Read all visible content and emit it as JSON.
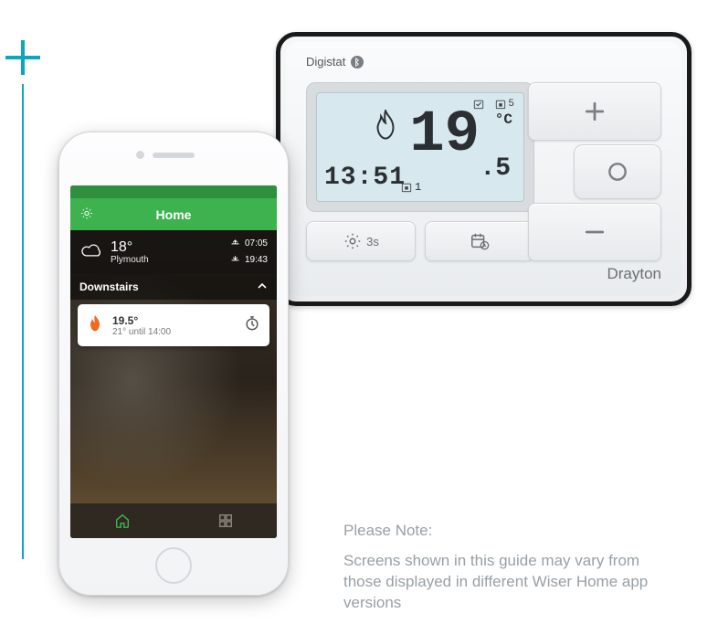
{
  "decor": {
    "accent": "#0aa7bf"
  },
  "thermostat": {
    "model": "Digistat",
    "brand": "Drayton",
    "bluetooth_icon": "bluetooth-icon",
    "lcd": {
      "time": "13:51",
      "flame_icon": "flame-icon",
      "schedule_top_label": "5",
      "temp_int": "19",
      "temp_dec": ".5",
      "temp_unit": "°C",
      "schedule_bottom": "1"
    },
    "buttons": {
      "settings_label": "3s",
      "settings_icon": "gear-icon",
      "schedule_icon": "calendar-clock-icon",
      "plus_icon": "plus-icon",
      "minus_icon": "minus-icon",
      "ok_icon": "circle-icon"
    }
  },
  "phone": {
    "header": {
      "title": "Home",
      "settings_icon": "gear-icon"
    },
    "weather": {
      "icon": "cloud-icon",
      "temp": "18°",
      "location": "Plymouth",
      "sunrise": "07:05",
      "sunset": "19:43"
    },
    "zone": {
      "name": "Downstairs",
      "card": {
        "temp": "19.5°",
        "subtitle": "21° until 14:00",
        "flame_icon": "flame-icon",
        "timer_icon": "stopwatch-icon"
      }
    },
    "tabs": {
      "home_icon": "home-icon",
      "grid_icon": "grid-icon"
    }
  },
  "note": {
    "title": "Please Note:",
    "body": "Screens shown in this guide may vary from those displayed in different Wiser Home app versions"
  }
}
